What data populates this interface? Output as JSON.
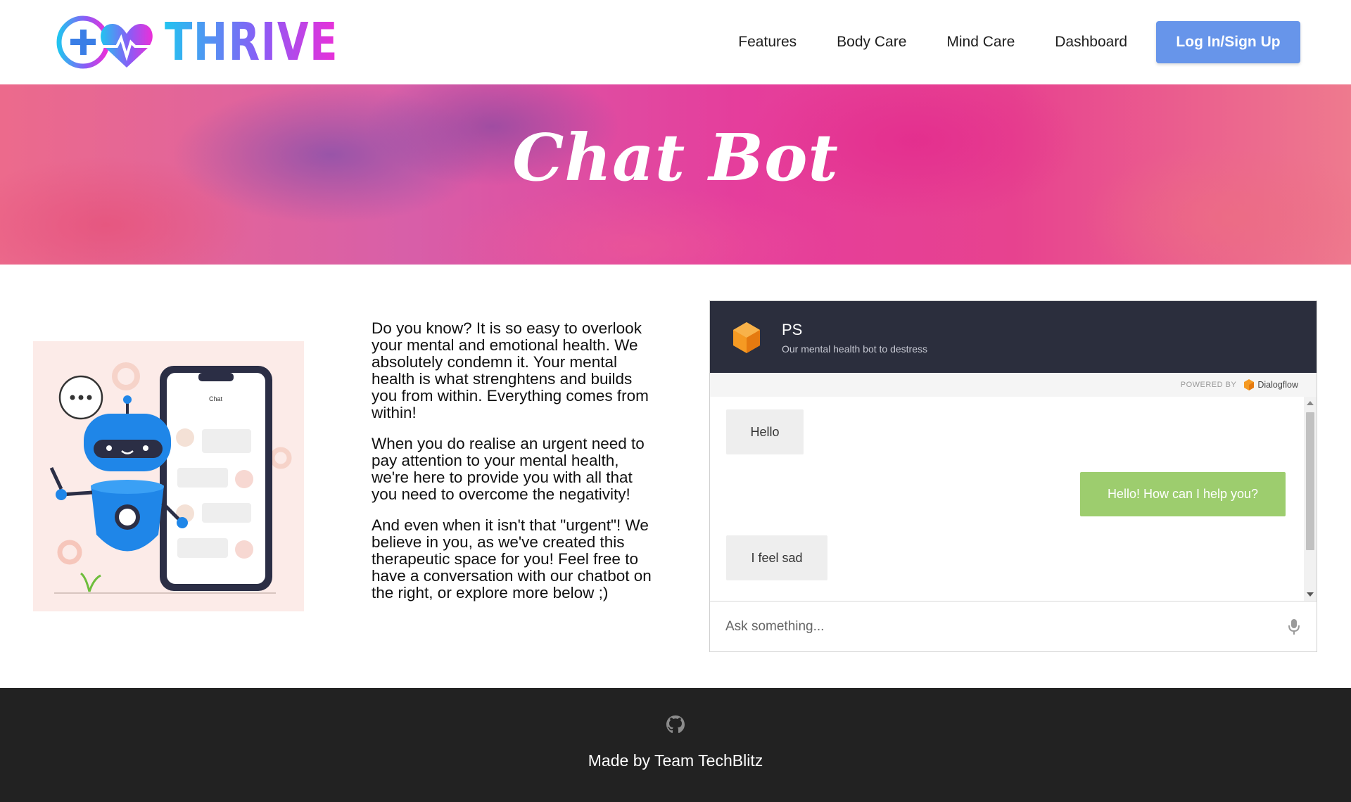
{
  "brand": {
    "name": "THRIVE",
    "logo_icon": "plus-heart-heartbeat-icon"
  },
  "nav": {
    "links": [
      "Features",
      "Body Care",
      "Mind Care",
      "Dashboard"
    ],
    "login_label": "Log In/Sign Up"
  },
  "hero": {
    "title": "Chat Bot"
  },
  "intro": {
    "paragraphs": [
      "Do you know? It is so easy to overlook your mental and emotional health. We absolutely condemn it. Your mental health is what strenghtens and builds you from within. Everything comes from within!",
      "When you do realise an urgent need to pay attention to your mental health, we're here to provide you with all that you need to overcome the negativity!",
      "And even when it isn't that \"urgent\"! We believe in you, as we've created this therapeutic space for you! Feel free to have a conversation with our chatbot on the right, or explore more below ;)"
    ]
  },
  "chat": {
    "title": "PS",
    "subtitle": "Our mental health bot to destress",
    "powered_by": "POWERED BY",
    "provider": "Dialogflow",
    "messages": [
      {
        "from": "user",
        "text": "Hello"
      },
      {
        "from": "bot",
        "text": "Hello! How can I help you?"
      },
      {
        "from": "user",
        "text": "I feel sad"
      }
    ],
    "input_placeholder": "Ask something..."
  },
  "footer": {
    "icon": "github-icon",
    "text": "Made by Team TechBlitz"
  },
  "colors": {
    "accent_button": "#6795ea",
    "chat_header": "#2b2e3d",
    "bot_bubble": "#9dcd6e",
    "user_bubble": "#eeeeee",
    "footer_bg": "#222222"
  }
}
